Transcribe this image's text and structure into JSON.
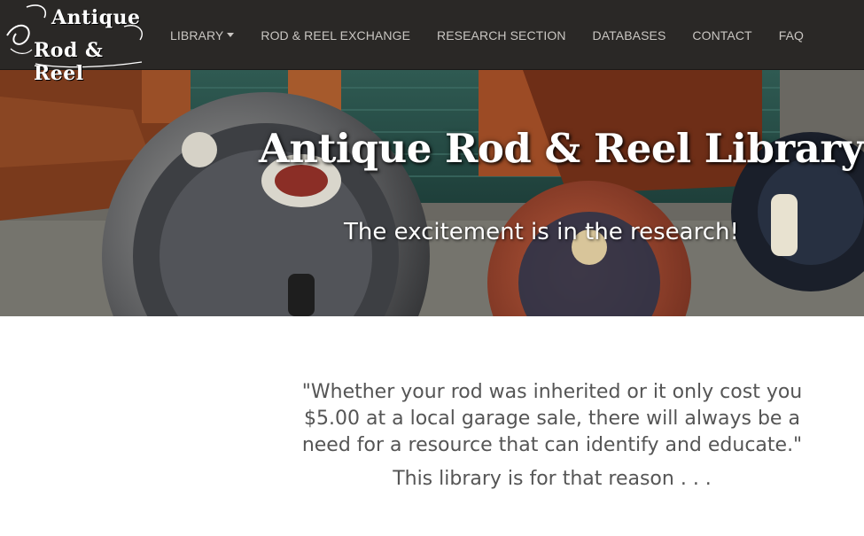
{
  "brand": {
    "line1": "Antique",
    "line2": "Rod & Reel"
  },
  "nav": {
    "items": [
      {
        "label": "LIBRARY",
        "has_dropdown": true
      },
      {
        "label": "ROD & REEL EXCHANGE"
      },
      {
        "label": "RESEARCH SECTION"
      },
      {
        "label": "DATABASES"
      },
      {
        "label": "CONTACT"
      },
      {
        "label": "FAQ"
      }
    ]
  },
  "hero": {
    "title": "Antique Rod & Reel Library",
    "subtitle": "The excitement is in the research!"
  },
  "main": {
    "quote": "\"Whether your rod was inherited or it only cost you $5.00 at a local garage sale, there will always be a need for a resource that can identify and educate.\"",
    "tagline": "This library is for that reason . . ."
  },
  "colors": {
    "navbar_bg": "#2a2826",
    "nav_text": "#c9c6c2",
    "body_text": "#555555"
  }
}
